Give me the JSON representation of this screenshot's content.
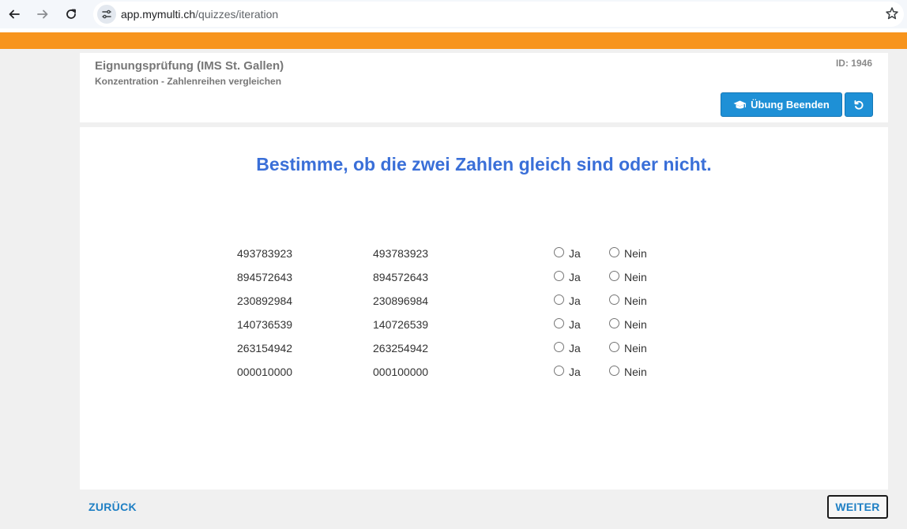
{
  "browser": {
    "url_domain": "app.mymulti.ch",
    "url_path": "/quizzes/iteration"
  },
  "header": {
    "title": "Eignungsprüfung (IMS St. Gallen)",
    "subtitle": "Konzentration - Zahlenreihen vergleichen",
    "id_label": "ID: 1946",
    "end_button_label": "Übung Beenden"
  },
  "main": {
    "instruction": "Bestimme, ob die zwei Zahlen gleich sind oder nicht.",
    "option_yes": "Ja",
    "option_no": "Nein",
    "rows": [
      {
        "a": "493783923",
        "b": "493783923"
      },
      {
        "a": "894572643",
        "b": "894572643"
      },
      {
        "a": "230892984",
        "b": "230896984"
      },
      {
        "a": "140736539",
        "b": "140726539"
      },
      {
        "a": "263154942",
        "b": "263254942"
      },
      {
        "a": "000010000",
        "b": "000100000"
      }
    ]
  },
  "footer": {
    "back_label": "ZURÜCK",
    "next_label": "WEITER"
  },
  "colors": {
    "accent_orange": "#f7941d",
    "button_blue": "#1e90d6",
    "instruction_blue": "#3a6fd8",
    "link_blue": "#1e7fc4"
  }
}
